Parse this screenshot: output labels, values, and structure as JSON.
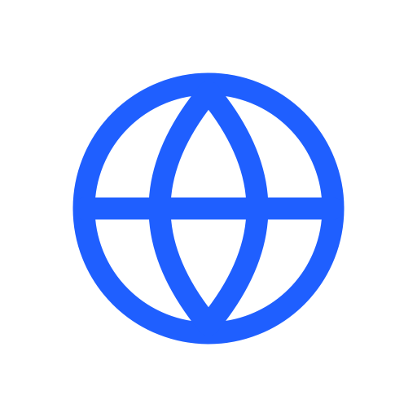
{
  "icon": {
    "name": "globe-icon",
    "color": "#1f5fff",
    "background": "#ffffff"
  }
}
